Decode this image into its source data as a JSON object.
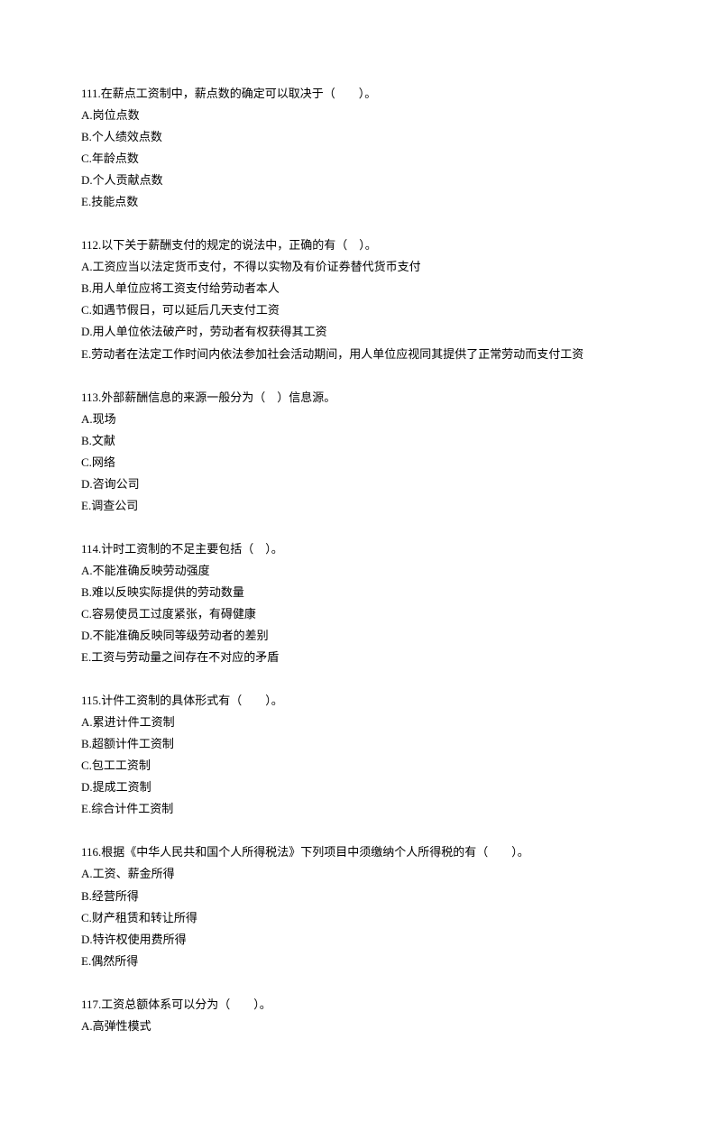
{
  "questions": [
    {
      "number": "111",
      "stem": "111.在薪点工资制中，薪点数的确定可以取决于（　　）。",
      "options": [
        "A.岗位点数",
        "B.个人绩效点数",
        "C.年龄点数",
        "D.个人贡献点数",
        "E.技能点数"
      ]
    },
    {
      "number": "112",
      "stem": "112.以下关于薪酬支付的规定的说法中，正确的有（　）。",
      "options": [
        "A.工资应当以法定货币支付，不得以实物及有价证券替代货币支付",
        "B.用人单位应将工资支付给劳动者本人",
        "C.如遇节假日，可以延后几天支付工资",
        "D.用人单位依法破产时，劳动者有权获得其工资",
        "E.劳动者在法定工作时间内依法参加社会活动期间，用人单位应视同其提供了正常劳动而支付工资"
      ]
    },
    {
      "number": "113",
      "stem": "113.外部薪酬信息的来源一般分为（　）信息源。",
      "options": [
        "A.现场",
        "B.文献",
        "C.网络",
        "D.咨询公司",
        "E.调查公司"
      ]
    },
    {
      "number": "114",
      "stem": "114.计时工资制的不足主要包括（　）。",
      "options": [
        "A.不能准确反映劳动强度",
        "B.难以反映实际提供的劳动数量",
        "C.容易使员工过度紧张，有碍健康",
        "D.不能准确反映同等级劳动者的差别",
        "E.工资与劳动量之间存在不对应的矛盾"
      ]
    },
    {
      "number": "115",
      "stem": "115.计件工资制的具体形式有（　　）。",
      "options": [
        "A.累进计件工资制",
        "B.超额计件工资制",
        "C.包工工资制",
        "D.提成工资制",
        "E.综合计件工资制"
      ]
    },
    {
      "number": "116",
      "stem": "116.根据《中华人民共和国个人所得税法》下列项目中须缴纳个人所得税的有（　　）。",
      "options": [
        "A.工资、薪金所得",
        "B.经营所得",
        "C.财产租赁和转让所得",
        "D.特许权使用费所得",
        "E.偶然所得"
      ]
    },
    {
      "number": "117",
      "stem": "117.工资总额体系可以分为（　　）。",
      "options": [
        "A.高弹性模式"
      ]
    }
  ]
}
